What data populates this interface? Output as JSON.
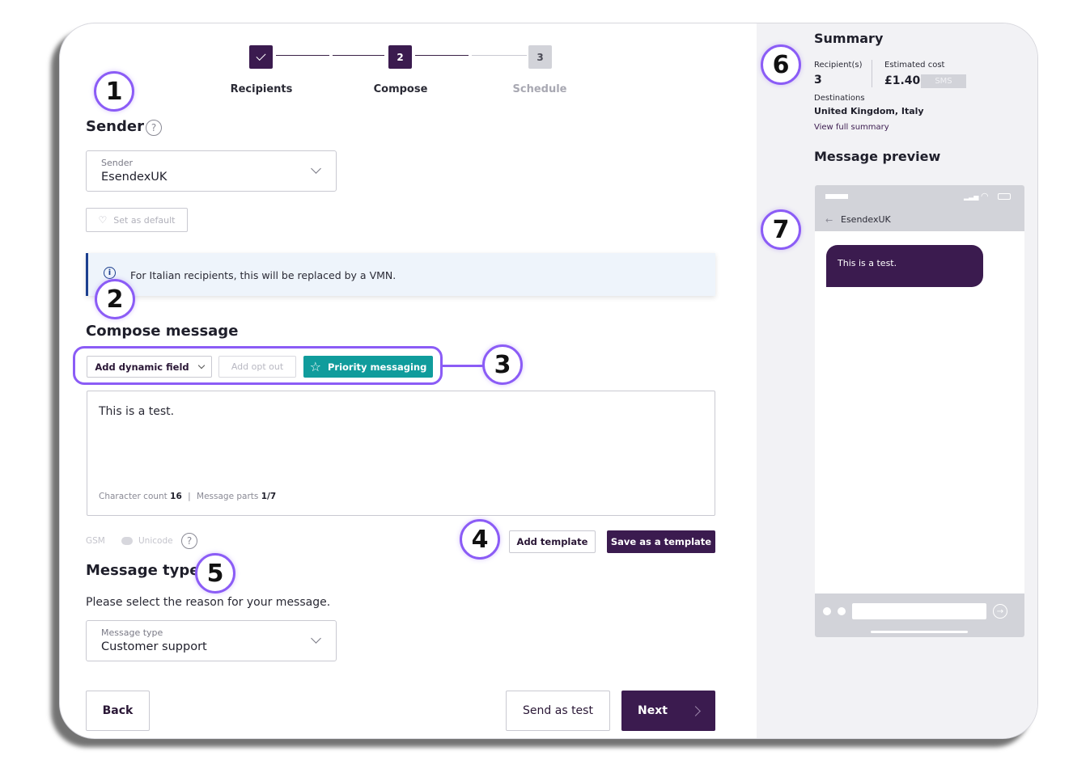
{
  "stepper": {
    "steps": [
      {
        "label": "Recipients",
        "number": "✓",
        "state": "done"
      },
      {
        "label": "Compose",
        "number": "2",
        "state": "active"
      },
      {
        "label": "Schedule",
        "number": "3",
        "state": "upcoming"
      }
    ]
  },
  "sender": {
    "title": "Sender",
    "select_label": "Sender",
    "select_value": "EsendexUK",
    "set_default": "Set as default",
    "info": "For Italian recipients, this will be replaced by a VMN."
  },
  "compose": {
    "title": "Compose message",
    "add_dynamic_field": "Add dynamic field",
    "add_opt_out": "Add opt out",
    "priority_messaging": "Priority messaging",
    "message_text": "This is a test.",
    "char_count_label": "Character count",
    "char_count_value": "16",
    "divider": "|",
    "parts_label": "Message parts",
    "parts_value": "1/7",
    "gsm": "GSM",
    "unicode": "Unicode",
    "add_template": "Add template",
    "save_template": "Save as a template"
  },
  "message_type": {
    "title": "Message type",
    "description": "Please select the reason for your message.",
    "select_label": "Message type",
    "select_value": "Customer support"
  },
  "footer": {
    "back": "Back",
    "send_test": "Send as test",
    "next": "Next"
  },
  "summary": {
    "title": "Summary",
    "recipients_label": "Recipient(s)",
    "recipients_value": "3",
    "cost_label": "Estimated cost",
    "cost_value": "£1.40",
    "channel": "SMS",
    "destinations_label": "Destinations",
    "destinations_value": "United Kingdom, Italy",
    "view_full": "View full summary"
  },
  "preview": {
    "title": "Message preview",
    "sender": "EsendexUK",
    "bubble_text": "This is a test."
  },
  "markers": [
    "1",
    "2",
    "3",
    "4",
    "5",
    "6",
    "7"
  ],
  "colors": {
    "brand": "#3b1b4f",
    "teal": "#109c9c",
    "annotation": "#8b5cf6",
    "info_bg": "#eef4fb",
    "info_bar": "#1c3f8f"
  }
}
